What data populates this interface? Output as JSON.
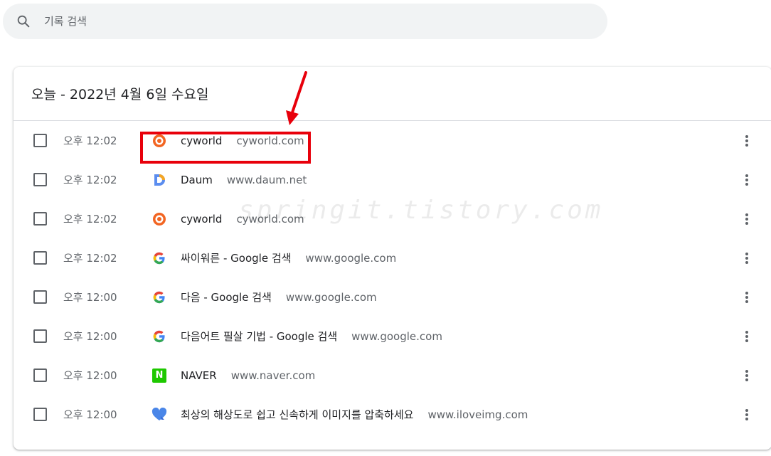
{
  "search": {
    "placeholder": "기록 검색"
  },
  "section": {
    "title": "오늘 - 2022년 4월 6일 수요일"
  },
  "rows": [
    {
      "time": "오후 12:02",
      "title": "cyworld",
      "domain": "cyworld.com",
      "icon": "cyworld-icon"
    },
    {
      "time": "오후 12:02",
      "title": "Daum",
      "domain": "www.daum.net",
      "icon": "daum-icon"
    },
    {
      "time": "오후 12:02",
      "title": "cyworld",
      "domain": "cyworld.com",
      "icon": "cyworld-icon"
    },
    {
      "time": "오후 12:02",
      "title": "싸이워른 - Google 검색",
      "domain": "www.google.com",
      "icon": "google-icon"
    },
    {
      "time": "오후 12:00",
      "title": "다음 - Google 검색",
      "domain": "www.google.com",
      "icon": "google-icon"
    },
    {
      "time": "오후 12:00",
      "title": "다음어트 필살 기법 - Google 검색",
      "domain": "www.google.com",
      "icon": "google-icon"
    },
    {
      "time": "오후 12:00",
      "title": "NAVER",
      "domain": "www.naver.com",
      "icon": "naver-icon"
    },
    {
      "time": "오후 12:00",
      "title": "최상의 해상도로 쉽고 신속하게 이미지를 압축하세요",
      "domain": "www.iloveimg.com",
      "icon": "iloveimg-icon"
    }
  ],
  "annotation": {
    "highlight_color": "#e8000b"
  },
  "watermark": {
    "text": "springit.tistory.com"
  },
  "colors": {
    "search_bg": "#f1f3f4",
    "secondary_text": "#5f6368",
    "primary_text": "#202124"
  }
}
